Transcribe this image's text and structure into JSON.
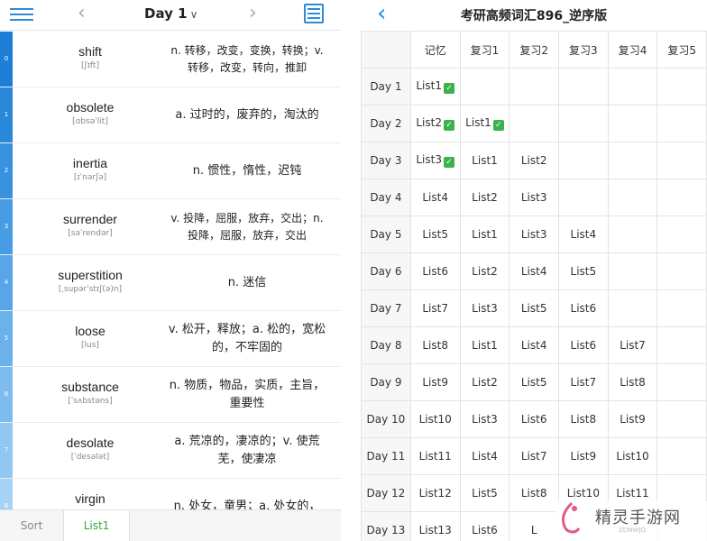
{
  "left": {
    "title": "Day 1",
    "title_arrow": "∨",
    "prev_glyph": "‹",
    "next_glyph": "›",
    "index_colors": [
      "#1f7fd6",
      "#2a88db",
      "#3892df",
      "#489ce3",
      "#58a6e7",
      "#6bb1eb",
      "#7ebcef",
      "#92c7f2",
      "#a6d2f5"
    ],
    "words": [
      {
        "index": "0",
        "word": "shift",
        "phonetic": "[ʃɪft]",
        "meaning": "n. 转移，改变，变换，转换；v. 转移，改变，转向，推卸"
      },
      {
        "index": "1",
        "word": "obsolete",
        "phonetic": "[ɑbsəˈlit]",
        "meaning": "a. 过时的，废弃的，淘汰的"
      },
      {
        "index": "2",
        "word": "inertia",
        "phonetic": "[ɪˈnərʃə]",
        "meaning": "n. 惯性，惰性，迟钝"
      },
      {
        "index": "3",
        "word": "surrender",
        "phonetic": "[səˈrendər]",
        "meaning": "v. 投降，屈服，放弃，交出；n. 投降，屈服，放弃，交出"
      },
      {
        "index": "4",
        "word": "superstition",
        "phonetic": "[ˌsupərˈstɪʃ(ə)n]",
        "meaning": "n. 迷信"
      },
      {
        "index": "5",
        "word": "loose",
        "phonetic": "[lus]",
        "meaning": "v. 松开，释放；a. 松的，宽松的，不牢固的"
      },
      {
        "index": "6",
        "word": "substance",
        "phonetic": "[ˈsʌbstəns]",
        "meaning": "n. 物质，物品，实质，主旨，重要性"
      },
      {
        "index": "7",
        "word": "desolate",
        "phonetic": "[ˈdesələt]",
        "meaning": "a. 荒凉的，凄凉的；v. 使荒芜，使凄凉"
      },
      {
        "index": "8",
        "word": "virgin",
        "phonetic": "",
        "meaning": "n. 处女，童男；a. 处女的，"
      }
    ],
    "tabs": {
      "sort": "Sort",
      "list1": "List1"
    }
  },
  "right": {
    "back_glyph": "‹",
    "title": "考研高频词汇896_逆序版",
    "headers": [
      "",
      "记忆",
      "复习1",
      "复习2",
      "复习3",
      "复习4",
      "复习5"
    ],
    "rows": [
      {
        "day": "Day 1",
        "cells": [
          {
            "t": "List1",
            "done": true
          },
          {
            "t": ""
          },
          {
            "t": ""
          },
          {
            "t": ""
          },
          {
            "t": ""
          },
          {
            "t": ""
          }
        ]
      },
      {
        "day": "Day 2",
        "cells": [
          {
            "t": "List2",
            "done": true
          },
          {
            "t": "List1",
            "done": true
          },
          {
            "t": ""
          },
          {
            "t": ""
          },
          {
            "t": ""
          },
          {
            "t": ""
          }
        ]
      },
      {
        "day": "Day 3",
        "cells": [
          {
            "t": "List3",
            "done": true
          },
          {
            "t": "List1"
          },
          {
            "t": "List2"
          },
          {
            "t": ""
          },
          {
            "t": ""
          },
          {
            "t": ""
          }
        ]
      },
      {
        "day": "Day 4",
        "cells": [
          {
            "t": "List4"
          },
          {
            "t": "List2"
          },
          {
            "t": "List3"
          },
          {
            "t": ""
          },
          {
            "t": ""
          },
          {
            "t": ""
          }
        ]
      },
      {
        "day": "Day 5",
        "cells": [
          {
            "t": "List5"
          },
          {
            "t": "List1"
          },
          {
            "t": "List3"
          },
          {
            "t": "List4"
          },
          {
            "t": ""
          },
          {
            "t": ""
          }
        ]
      },
      {
        "day": "Day 6",
        "cells": [
          {
            "t": "List6"
          },
          {
            "t": "List2"
          },
          {
            "t": "List4"
          },
          {
            "t": "List5"
          },
          {
            "t": ""
          },
          {
            "t": ""
          }
        ]
      },
      {
        "day": "Day 7",
        "cells": [
          {
            "t": "List7"
          },
          {
            "t": "List3"
          },
          {
            "t": "List5"
          },
          {
            "t": "List6"
          },
          {
            "t": ""
          },
          {
            "t": ""
          }
        ]
      },
      {
        "day": "Day 8",
        "cells": [
          {
            "t": "List8"
          },
          {
            "t": "List1"
          },
          {
            "t": "List4"
          },
          {
            "t": "List6"
          },
          {
            "t": "List7"
          },
          {
            "t": ""
          }
        ]
      },
      {
        "day": "Day 9",
        "cells": [
          {
            "t": "List9"
          },
          {
            "t": "List2"
          },
          {
            "t": "List5"
          },
          {
            "t": "List7"
          },
          {
            "t": "List8"
          },
          {
            "t": ""
          }
        ]
      },
      {
        "day": "Day 10",
        "cells": [
          {
            "t": "List10"
          },
          {
            "t": "List3"
          },
          {
            "t": "List6"
          },
          {
            "t": "List8"
          },
          {
            "t": "List9"
          },
          {
            "t": ""
          }
        ]
      },
      {
        "day": "Day 11",
        "cells": [
          {
            "t": "List11"
          },
          {
            "t": "List4"
          },
          {
            "t": "List7"
          },
          {
            "t": "List9"
          },
          {
            "t": "List10"
          },
          {
            "t": ""
          }
        ]
      },
      {
        "day": "Day 12",
        "cells": [
          {
            "t": "List12"
          },
          {
            "t": "List5"
          },
          {
            "t": "List8"
          },
          {
            "t": "List10"
          },
          {
            "t": "List11"
          },
          {
            "t": ""
          }
        ]
      },
      {
        "day": "Day 13",
        "cells": [
          {
            "t": "List13"
          },
          {
            "t": "List6"
          },
          {
            "t": "L"
          },
          {
            "t": ""
          },
          {
            "t": ""
          },
          {
            "t": ""
          }
        ]
      }
    ]
  },
  "watermark": {
    "text": "精灵手游网",
    "sub": "ZDNWJO"
  }
}
